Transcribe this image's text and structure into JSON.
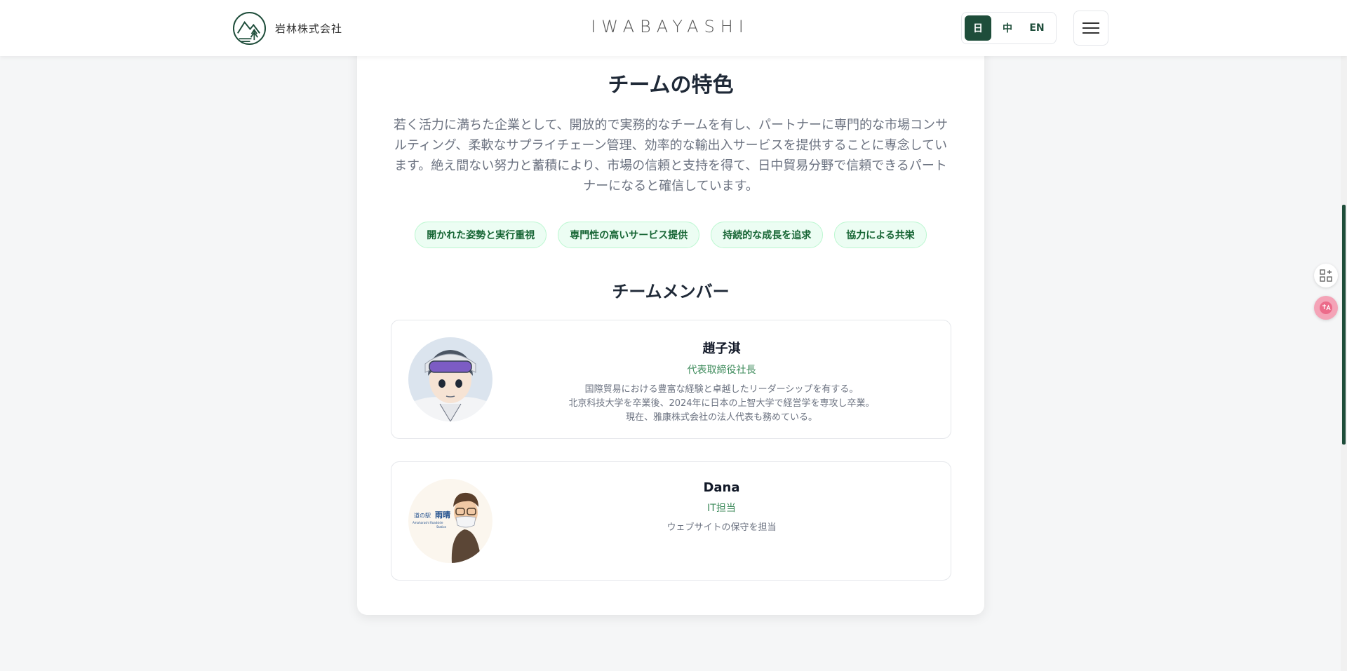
{
  "header": {
    "company": "岩林株式会社",
    "brand": "IWABAYASHI",
    "languages": [
      {
        "label": "日",
        "active": true
      },
      {
        "label": "中",
        "active": false
      },
      {
        "label": "EN",
        "active": false
      }
    ],
    "menu_icon": "hamburger-menu-icon"
  },
  "features": {
    "title": "チームの特色",
    "intro_lines": [
      "若く活力に満ちた企業として、開放的で実務的なチームを有し、パートナーに専門的な市場コンサ",
      "ルティング、柔軟なサプライチェーン管理、効率的な輸出入サービスを提供することに専念してい",
      "ます。絶え間ない努力と蓄積により、市場の信頼と支持を得て、日中貿易分野で信頼できるパート",
      "ナーになると確信しています。"
    ],
    "tags": [
      "開かれた姿勢と実行重視",
      "専門性の高いサービス提供",
      "持続的な成長を追求",
      "協力による共栄"
    ]
  },
  "team": {
    "title": "チームメンバー",
    "members": [
      {
        "name": "趙子淇",
        "role": "代表取締役社長",
        "desc_lines": [
          "国際貿易における豊富な経験と卓越したリーダーシップを有する。",
          "北京科技大学を卒業後、2024年に日本の上智大学で経営学を専攻し卒業。",
          "現在、雅康株式会社の法人代表も務めている。"
        ]
      },
      {
        "name": "Dana",
        "role": "IT担当",
        "desc_lines": [
          "ウェブサイトの保守を担当"
        ],
        "avatar_sign": {
          "line1": "道の駅",
          "line2": "雨晴",
          "line3": "Amaharashi Roadside",
          "line4": "Station"
        }
      }
    ]
  },
  "side_widgets": [
    "app-grid-icon",
    "translate-icon"
  ],
  "colors": {
    "accent": "#1e4d3a",
    "tag_bg": "#ecfdf3",
    "role": "#3c8a5a"
  }
}
